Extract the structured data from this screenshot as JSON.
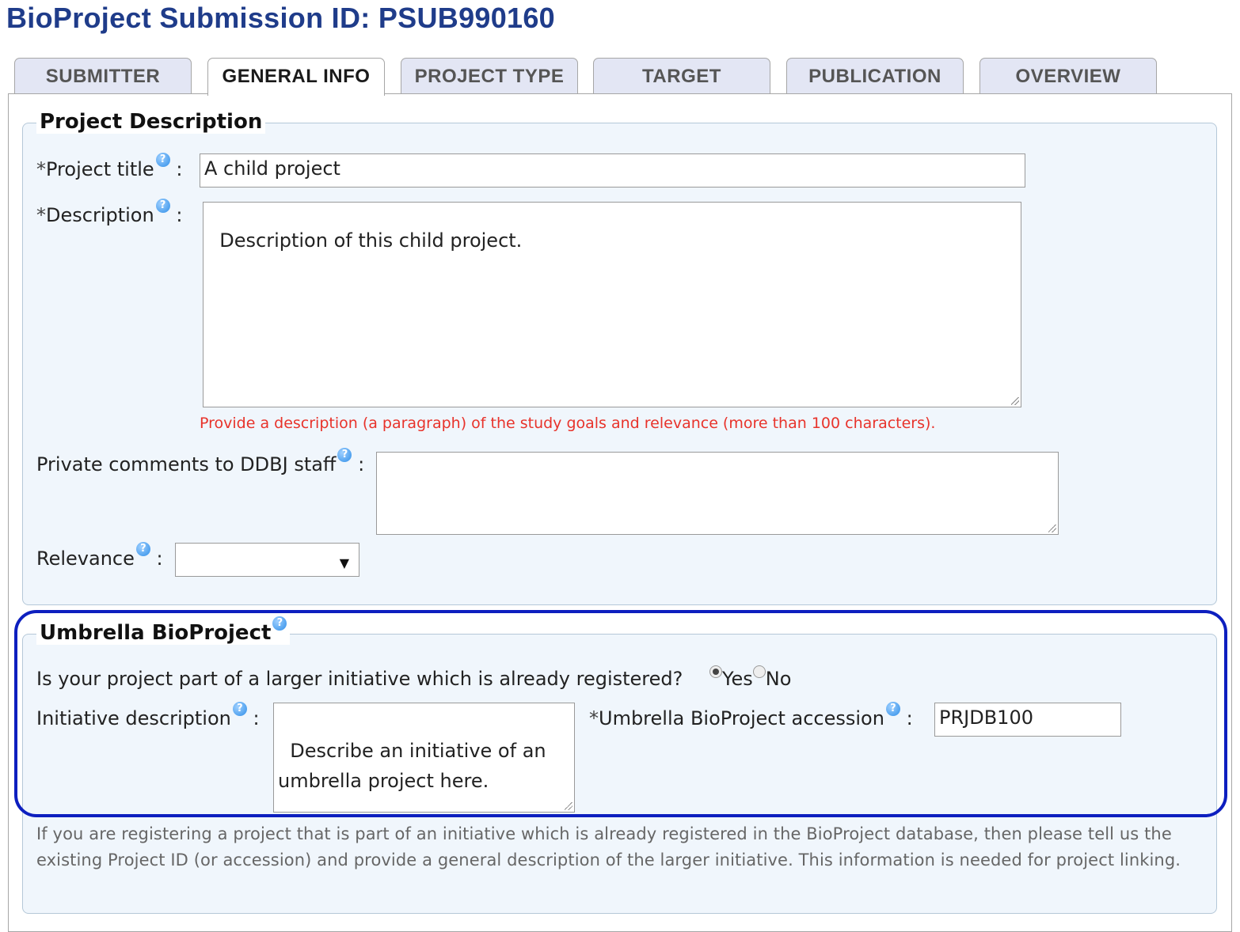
{
  "page": {
    "title": "BioProject Submission ID: PSUB990160"
  },
  "tabs": [
    {
      "label": "SUBMITTER",
      "active": false
    },
    {
      "label": "GENERAL INFO",
      "active": true
    },
    {
      "label": "PROJECT TYPE",
      "active": false
    },
    {
      "label": "TARGET",
      "active": false
    },
    {
      "label": "PUBLICATION",
      "active": false
    },
    {
      "label": "OVERVIEW",
      "active": false
    }
  ],
  "project_description": {
    "legend": "Project Description",
    "required_marker": "*",
    "help_glyph": "?",
    "colon": ":",
    "project_title": {
      "label": "Project title",
      "value": "A child project"
    },
    "description": {
      "label": "Description",
      "value": "Description of this child project.",
      "hint": "Provide a description (a paragraph) of the study goals and relevance (more than 100 characters)."
    },
    "private_comments": {
      "label": "Private comments to DDBJ staff",
      "value": ""
    },
    "relevance": {
      "label": "Relevance",
      "selected": ""
    }
  },
  "umbrella": {
    "legend": "Umbrella BioProject",
    "question": "Is your project part of a larger initiative which is already registered?",
    "options": [
      {
        "label": "Yes",
        "checked": true
      },
      {
        "label": "No",
        "checked": false
      }
    ],
    "initiative_description": {
      "label": "Initiative description",
      "value": "Describe an initiative of an umbrella project here."
    },
    "accession": {
      "label": "Umbrella BioProject accession",
      "value": "PRJDB100"
    },
    "note": "If you are registering a project that is part of an initiative which is already registered in the BioProject database, then please tell us the existing Project ID (or accession) and provide a general description of the larger initiative. This information is needed for project linking."
  },
  "colors": {
    "title": "#1f3c8a",
    "tab_inactive_bg": "#e3e6f4",
    "fieldset_bg": "#f0f6fc",
    "hint_red": "#e8332b",
    "highlight_border": "#0d1fbf"
  },
  "icons": {
    "help": "help-circle-icon",
    "select": "dropdown-arrow-icon",
    "resize": "resize-grip-icon"
  }
}
